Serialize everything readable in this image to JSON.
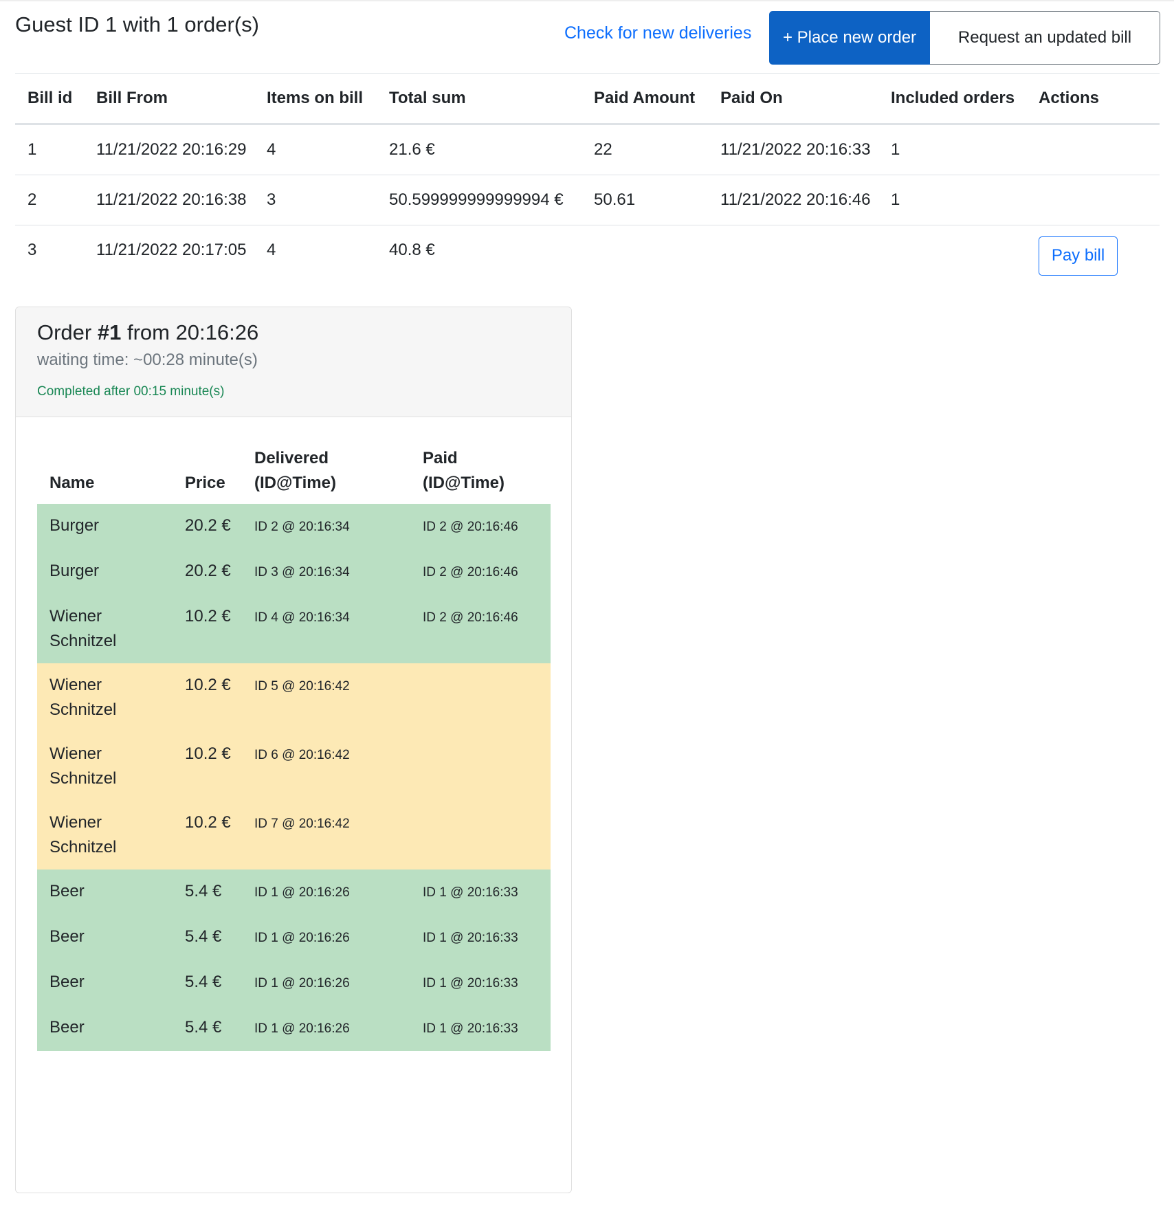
{
  "header": {
    "title_prefix": "Guest ",
    "title_strong": "ID 1",
    "title_suffix": " with 1 order(s)",
    "check_link": "Check for new deliveries",
    "place_order": "+ Place new order",
    "request_bill": "Request an updated bill"
  },
  "bills": {
    "columns": [
      "Bill id",
      "Bill From",
      "Items on bill",
      "Total sum",
      "Paid Amount",
      "Paid On",
      "Included orders",
      "Actions"
    ],
    "rows": [
      {
        "id": "1",
        "from": "11/21/2022 20:16:29",
        "items": "4",
        "total": "21.6 €",
        "paid_amount": "22",
        "paid_on": "11/21/2022 20:16:33",
        "orders": "1"
      },
      {
        "id": "2",
        "from": "11/21/2022 20:16:38",
        "items": "3",
        "total": "50.599999999999994 €",
        "paid_amount": "50.61",
        "paid_on": "11/21/2022 20:16:46",
        "orders": "1"
      },
      {
        "id": "3",
        "from": "11/21/2022 20:17:05",
        "items": "4",
        "total": "40.8 €",
        "paid_amount": "",
        "paid_on": "",
        "orders": "",
        "action": "Pay bill"
      }
    ]
  },
  "order": {
    "title_prefix": "Order ",
    "title_strong": "#1",
    "title_suffix": " from 20:16:26",
    "waiting": "waiting time: ~00:28 minute(s)",
    "completed": "Completed after 00:15 minute(s)",
    "columns": {
      "name": "Name",
      "price": "Price",
      "delivered_line1": "Delivered",
      "delivered_line2": "(ID@Time)",
      "paid_line1": "Paid",
      "paid_line2": "(ID@Time)"
    },
    "items": [
      {
        "name": "Burger",
        "price": "20.2 €",
        "delivered": "ID 2 @ 20:16:34",
        "paid": "ID 2 @ 20:16:46",
        "status": "green"
      },
      {
        "name": "Burger",
        "price": "20.2 €",
        "delivered": "ID 3 @ 20:16:34",
        "paid": "ID 2 @ 20:16:46",
        "status": "green"
      },
      {
        "name": "Wiener Schnitzel",
        "price": "10.2 €",
        "delivered": "ID 4 @ 20:16:34",
        "paid": "ID 2 @ 20:16:46",
        "status": "green"
      },
      {
        "name": "Wiener Schnitzel",
        "price": "10.2 €",
        "delivered": "ID 5 @ 20:16:42",
        "paid": "",
        "status": "yellow"
      },
      {
        "name": "Wiener Schnitzel",
        "price": "10.2 €",
        "delivered": "ID 6 @ 20:16:42",
        "paid": "",
        "status": "yellow"
      },
      {
        "name": "Wiener Schnitzel",
        "price": "10.2 €",
        "delivered": "ID 7 @ 20:16:42",
        "paid": "",
        "status": "yellow"
      },
      {
        "name": "Beer",
        "price": "5.4 €",
        "delivered": "ID 1 @ 20:16:26",
        "paid": "ID 1 @ 20:16:33",
        "status": "green"
      },
      {
        "name": "Beer",
        "price": "5.4 €",
        "delivered": "ID 1 @ 20:16:26",
        "paid": "ID 1 @ 20:16:33",
        "status": "green"
      },
      {
        "name": "Beer",
        "price": "5.4 €",
        "delivered": "ID 1 @ 20:16:26",
        "paid": "ID 1 @ 20:16:33",
        "status": "green"
      },
      {
        "name": "Beer",
        "price": "5.4 €",
        "delivered": "ID 1 @ 20:16:26",
        "paid": "ID 1 @ 20:16:33",
        "status": "green"
      }
    ]
  },
  "colors": {
    "primary": "#0d62c4",
    "link": "#0d6efd",
    "success_text": "#198754",
    "row_paid": "#badfc3",
    "row_unpaid": "#fde9b5"
  }
}
